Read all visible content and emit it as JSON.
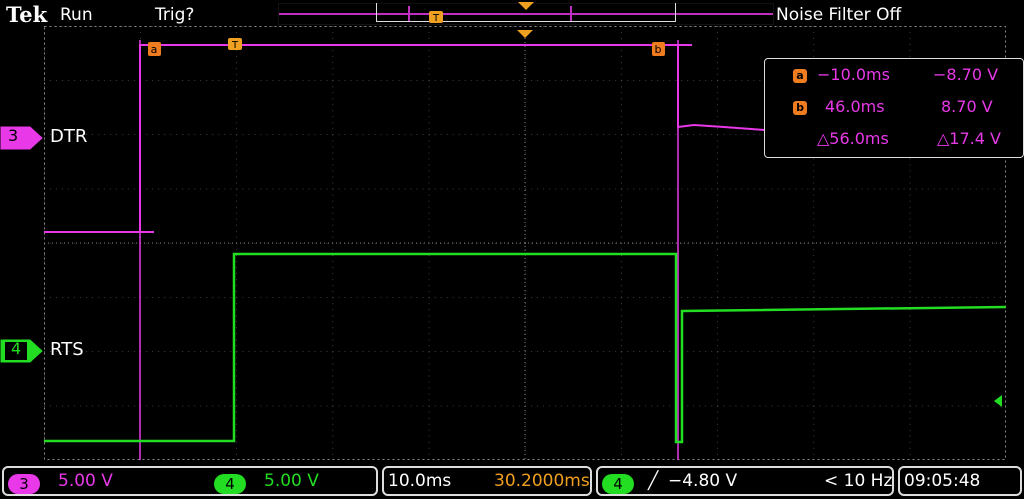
{
  "header": {
    "brand": "Tek",
    "acq_state": "Run",
    "trigger_status": "Trig?",
    "noise_filter": "Noise Filter Off"
  },
  "channels": [
    {
      "id": "3",
      "name": "DTR",
      "color": "#e838e8"
    },
    {
      "id": "4",
      "name": "RTS",
      "color": "#22dd22"
    }
  ],
  "cursor_labels": {
    "a": "a",
    "b": "b",
    "trigger": "T"
  },
  "cursors": {
    "a": {
      "time": "−10.0ms",
      "volt": "−8.70 V"
    },
    "b": {
      "time": "46.0ms",
      "volt": "8.70 V"
    },
    "delta": {
      "time": "△56.0ms",
      "volt": "△17.4 V"
    }
  },
  "footer": {
    "ch3_id": "3",
    "ch3_scale": "5.00 V",
    "ch4_id": "4",
    "ch4_scale": "5.00 V",
    "timebase": "10.0ms",
    "position": "30.2000ms",
    "trig_source": "4",
    "trig_slope": "╱",
    "trig_level": "−4.80 V",
    "trig_freq": "< 10 Hz",
    "time": "09:05:48"
  },
  "colors": {
    "ch3": "#e838e8",
    "ch4": "#22dd22",
    "cursor": "#f07c20",
    "grid": "#7a7a7a",
    "trigger_marker": "#f0a020"
  }
}
